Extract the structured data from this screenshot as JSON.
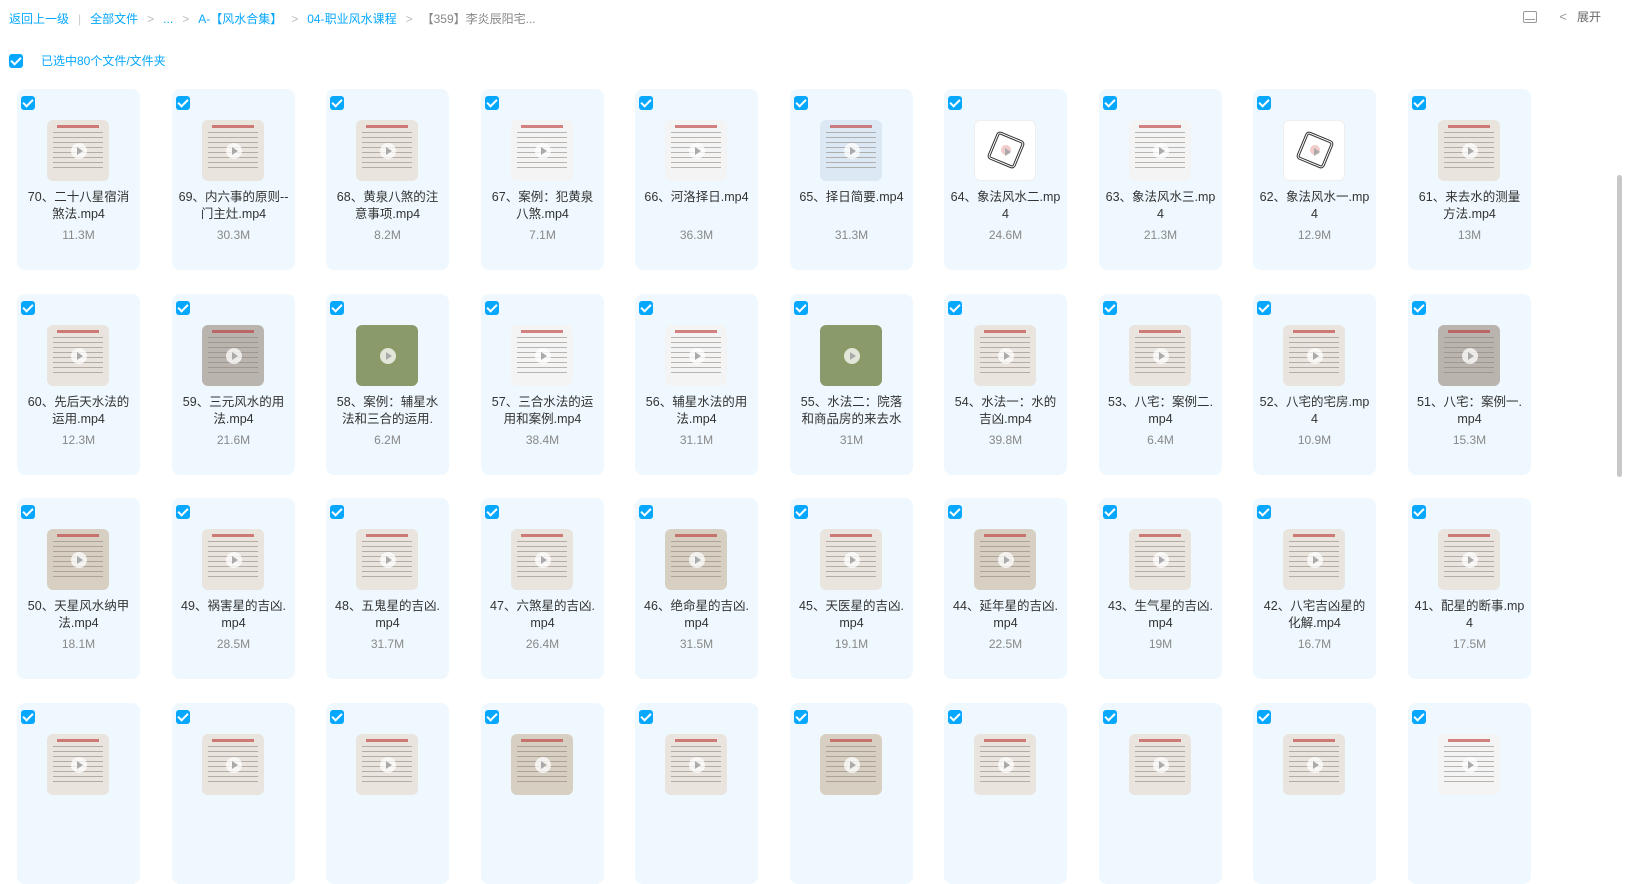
{
  "breadcrumb": {
    "back": "返回上一级",
    "all_files": "全部文件",
    "ellipsis": "...",
    "level1": "A-【风水合集】",
    "level2": "04-职业风水课程",
    "current": "【359】李炎辰阳宅..."
  },
  "toolbar": {
    "expand_label": "展开",
    "layout_icon": "layout-icon",
    "collapse_icon": "chevron-left-icon"
  },
  "selection": {
    "label": "已选中80个文件/文件夹",
    "checked": true
  },
  "accent_color": "#06a7ff",
  "files": [
    {
      "name": "70、二十八星宿消煞法.mp4",
      "size": "11.3M",
      "thumb": "paper"
    },
    {
      "name": "69、内六事的原则--门主灶.mp4",
      "size": "30.3M",
      "thumb": "paper"
    },
    {
      "name": "68、黄泉八煞的注意事项.mp4",
      "size": "8.2M",
      "thumb": "paper"
    },
    {
      "name": "67、案例：犯黄泉八煞.mp4",
      "size": "7.1M",
      "thumb": "grid"
    },
    {
      "name": "66、河洛择日.mp4",
      "size": "36.3M",
      "thumb": "grid"
    },
    {
      "name": "65、择日简要.mp4",
      "size": "31.3M",
      "thumb": "blue"
    },
    {
      "name": "64、象法风水二.mp4",
      "size": "24.6M",
      "thumb": "white"
    },
    {
      "name": "63、象法风水三.mp4",
      "size": "21.3M",
      "thumb": "grid"
    },
    {
      "name": "62、象法风水一.mp4",
      "size": "12.9M",
      "thumb": "white"
    },
    {
      "name": "61、来去水的测量方法.mp4",
      "size": "13M",
      "thumb": "paper"
    },
    {
      "name": "60、先后天水法的运用.mp4",
      "size": "12.3M",
      "thumb": "paper"
    },
    {
      "name": "59、三元风水的用法.mp4",
      "size": "21.6M",
      "thumb": "gray"
    },
    {
      "name": "58、案例：辅星水法和三合的运用.",
      "size": "6.2M",
      "thumb": "photo"
    },
    {
      "name": "57、三合水法的运用和案例.mp4",
      "size": "38.4M",
      "thumb": "grid"
    },
    {
      "name": "56、辅星水法的用法.mp4",
      "size": "31.1M",
      "thumb": "grid"
    },
    {
      "name": "55、水法二：院落和商品房的来去水",
      "size": "31M",
      "thumb": "photo"
    },
    {
      "name": "54、水法一：水的吉凶.mp4",
      "size": "39.8M",
      "thumb": "paper"
    },
    {
      "name": "53、八宅：案例二.mp4",
      "size": "6.4M",
      "thumb": "paper"
    },
    {
      "name": "52、八宅的宅房.mp4",
      "size": "10.9M",
      "thumb": "paper"
    },
    {
      "name": "51、八宅：案例一.mp4",
      "size": "15.3M",
      "thumb": "gray"
    },
    {
      "name": "50、天星风水纳甲法.mp4",
      "size": "18.1M",
      "thumb": "dark"
    },
    {
      "name": "49、祸害星的吉凶.mp4",
      "size": "28.5M",
      "thumb": "paper"
    },
    {
      "name": "48、五鬼星的吉凶.mp4",
      "size": "31.7M",
      "thumb": "paper"
    },
    {
      "name": "47、六煞星的吉凶.mp4",
      "size": "26.4M",
      "thumb": "paper"
    },
    {
      "name": "46、绝命星的吉凶.mp4",
      "size": "31.5M",
      "thumb": "dark"
    },
    {
      "name": "45、天医星的吉凶.mp4",
      "size": "19.1M",
      "thumb": "paper"
    },
    {
      "name": "44、延年星的吉凶.mp4",
      "size": "22.5M",
      "thumb": "dark"
    },
    {
      "name": "43、生气星的吉凶.mp4",
      "size": "19M",
      "thumb": "paper"
    },
    {
      "name": "42、八宅吉凶星的化解.mp4",
      "size": "16.7M",
      "thumb": "paper"
    },
    {
      "name": "41、配星的断事.mp4",
      "size": "17.5M",
      "thumb": "paper"
    },
    {
      "name": "",
      "size": "",
      "thumb": "paper"
    },
    {
      "name": "",
      "size": "",
      "thumb": "paper"
    },
    {
      "name": "",
      "size": "",
      "thumb": "paper"
    },
    {
      "name": "",
      "size": "",
      "thumb": "dark"
    },
    {
      "name": "",
      "size": "",
      "thumb": "paper"
    },
    {
      "name": "",
      "size": "",
      "thumb": "dark"
    },
    {
      "name": "",
      "size": "",
      "thumb": "paper"
    },
    {
      "name": "",
      "size": "",
      "thumb": "paper"
    },
    {
      "name": "",
      "size": "",
      "thumb": "paper"
    },
    {
      "name": "",
      "size": "",
      "thumb": "grid"
    }
  ]
}
